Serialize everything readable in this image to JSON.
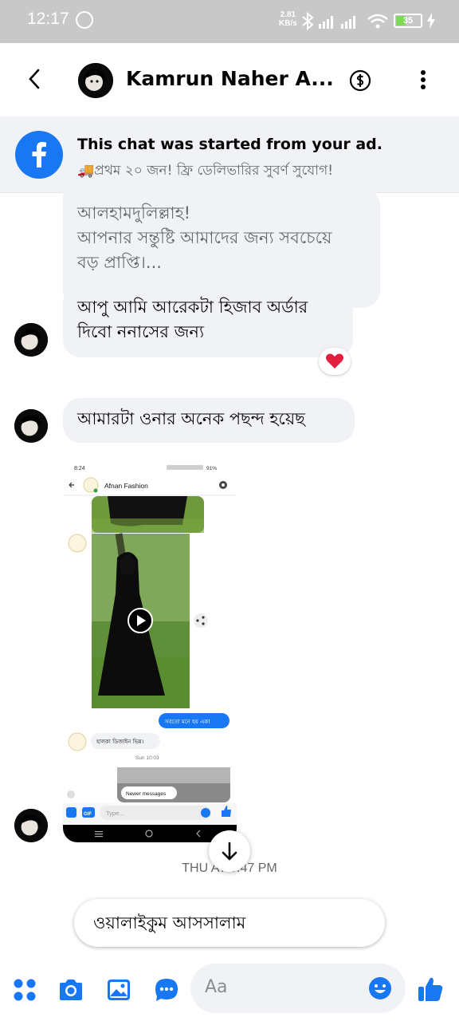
{
  "status_bar": {
    "time": "12:17",
    "speed_value": "2.81",
    "speed_unit": "KB/s",
    "battery": "35"
  },
  "header": {
    "contact_name": "Kamrun Naher A..."
  },
  "ad_banner": {
    "title": "This chat was started from your ad.",
    "subtitle": "🚚প্রথম ২০ জন! ফ্রি ডেলিভারির সুবর্ণ সুযোগ!"
  },
  "messages": {
    "reply_quote_line1": "আলহামদুলিল্লাহ!",
    "reply_quote_line2": "আপনার সন্তুষ্টি আমাদের জন্য সবচেয়ে",
    "reply_quote_line3": "বড় প্রাপ্তি।...",
    "msg1_line1": "আপু আমি আরেকটা হিজাব অর্ডার",
    "msg1_line2": "দিবো ননাসের জন্য",
    "msg1_reaction": "❤️",
    "msg2": "আমারটা ওনার অনেক পছন্দ হয়েছ"
  },
  "shared_screenshot": {
    "time": "8:24",
    "status": "91%",
    "page_name": "Afnan Fashion",
    "bubble_sent": "সবতো মনে হয় এক!",
    "bubble_received": "হালকা ডিজাইন ভিন্ন।",
    "timestamp": "Sun 10:03",
    "newer_messages": "Newer messages",
    "composer_placeholder": "Type...",
    "gif_label": "GIF"
  },
  "time_label": "THU AT 5:47 PM",
  "quick_reply": "ওয়ালাইকুম আসসালাম",
  "composer": {
    "placeholder": "Aa"
  },
  "colors": {
    "accent": "#1877f2",
    "bubble_gray": "#f0f2f5",
    "reaction_heart": "#e41e3f"
  }
}
